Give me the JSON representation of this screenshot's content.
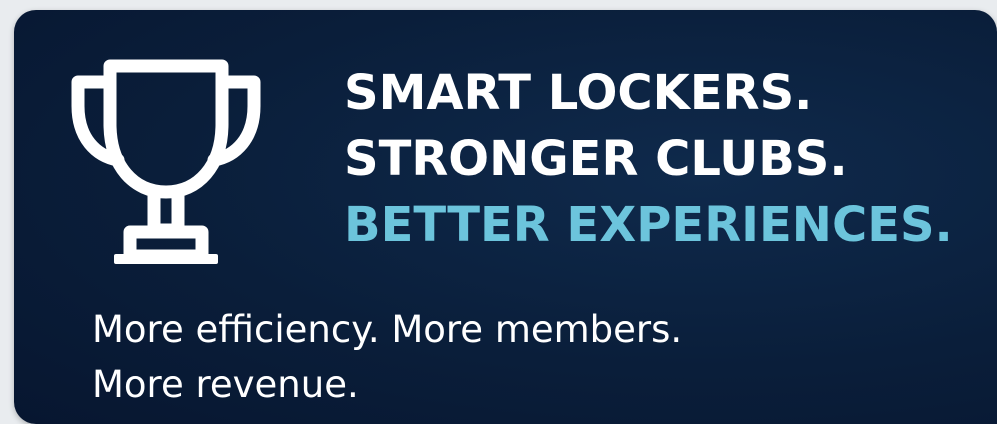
{
  "banner": {
    "headline": {
      "line1": "SMART LOCKERS.",
      "line2": "STRONGER CLUBS.",
      "line3": "BETTER EXPERIENCES."
    },
    "tagline": {
      "line1": "More efficiency. More members.",
      "line2": "More revenue."
    },
    "icon": "trophy-icon",
    "colors": {
      "background": "#0a1e3a",
      "text": "#ffffff",
      "accent": "#6cc4dc"
    }
  }
}
